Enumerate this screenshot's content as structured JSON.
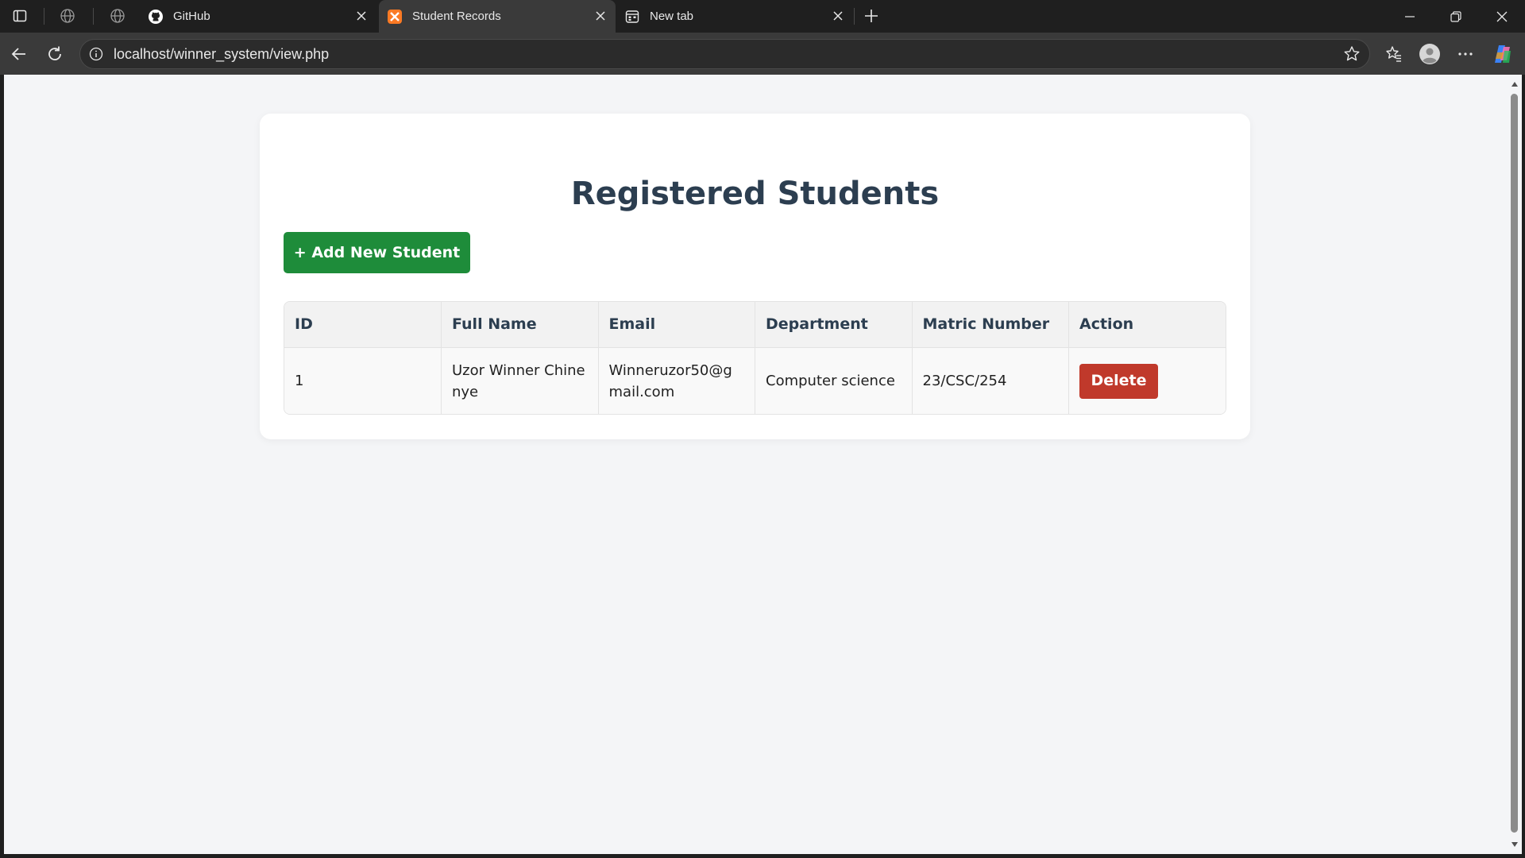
{
  "browser": {
    "tabs": [
      {
        "title": "GitHub"
      },
      {
        "title": "Student Records"
      },
      {
        "title": "New tab"
      }
    ],
    "url": "localhost/winner_system/view.php"
  },
  "page": {
    "title": "Registered Students",
    "add_button": "+ Add New Student",
    "table": {
      "headers": [
        "ID",
        "Full Name",
        "Email",
        "Department",
        "Matric Number",
        "Action"
      ],
      "rows": [
        {
          "id": "1",
          "full_name": "Uzor Winner Chinenye",
          "email": "Winneruzor50@gmail.com",
          "department": "Computer science",
          "matric_number": "23/CSC/254",
          "action": "Delete"
        }
      ]
    }
  },
  "colors": {
    "add_button": "#1e8c3a",
    "delete_button": "#c0392b",
    "heading": "#2c3e50",
    "page_bg": "#f4f5f7"
  },
  "icons": [
    "sidebar-toggle-icon",
    "globe-icon",
    "github-icon",
    "xampp-icon",
    "new-tab-icon",
    "close-icon",
    "plus-icon",
    "minimize-icon",
    "restore-icon",
    "back-icon",
    "reload-icon",
    "info-icon",
    "star-icon",
    "favorites-icon",
    "profile-icon",
    "more-icon",
    "copilot-icon"
  ]
}
